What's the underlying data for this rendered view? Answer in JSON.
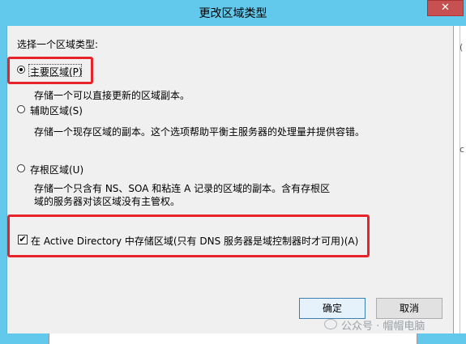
{
  "window": {
    "title": "更改区域类型",
    "close_glyph": "✕"
  },
  "prompt_label": "选择一个区域类型:",
  "zone_options": [
    {
      "label": "主要区域(P)",
      "selected": true,
      "description_lines": [
        "存储一个可以直接更新的区域副本。"
      ]
    },
    {
      "label": "辅助区域(S)",
      "selected": false,
      "description_lines": [
        "存储一个现存区域的副本。这个选项帮助平衡主服务器的处理量并提供容错。"
      ]
    },
    {
      "label": "存根区域(U)",
      "selected": false,
      "description_lines": [
        "存储一个只含有 NS、SOA 和粘连 A 记录的区域的副本。含有存根区",
        "域的服务器对该区域没有主管权。"
      ]
    }
  ],
  "ad_checkbox": {
    "label": "在 Active Directory 中存储区域(只有 DNS 服务器是域控制器时才可用)(A)",
    "checked": true
  },
  "buttons": {
    "ok": "确定",
    "cancel": "取消"
  },
  "watermark": "公众号 · 帽帽电脑",
  "side_marks": [
    "(",
    "c"
  ],
  "colors": {
    "titlebar": "#62c8ec",
    "highlight": "#e8242b",
    "close": "#c75050"
  }
}
